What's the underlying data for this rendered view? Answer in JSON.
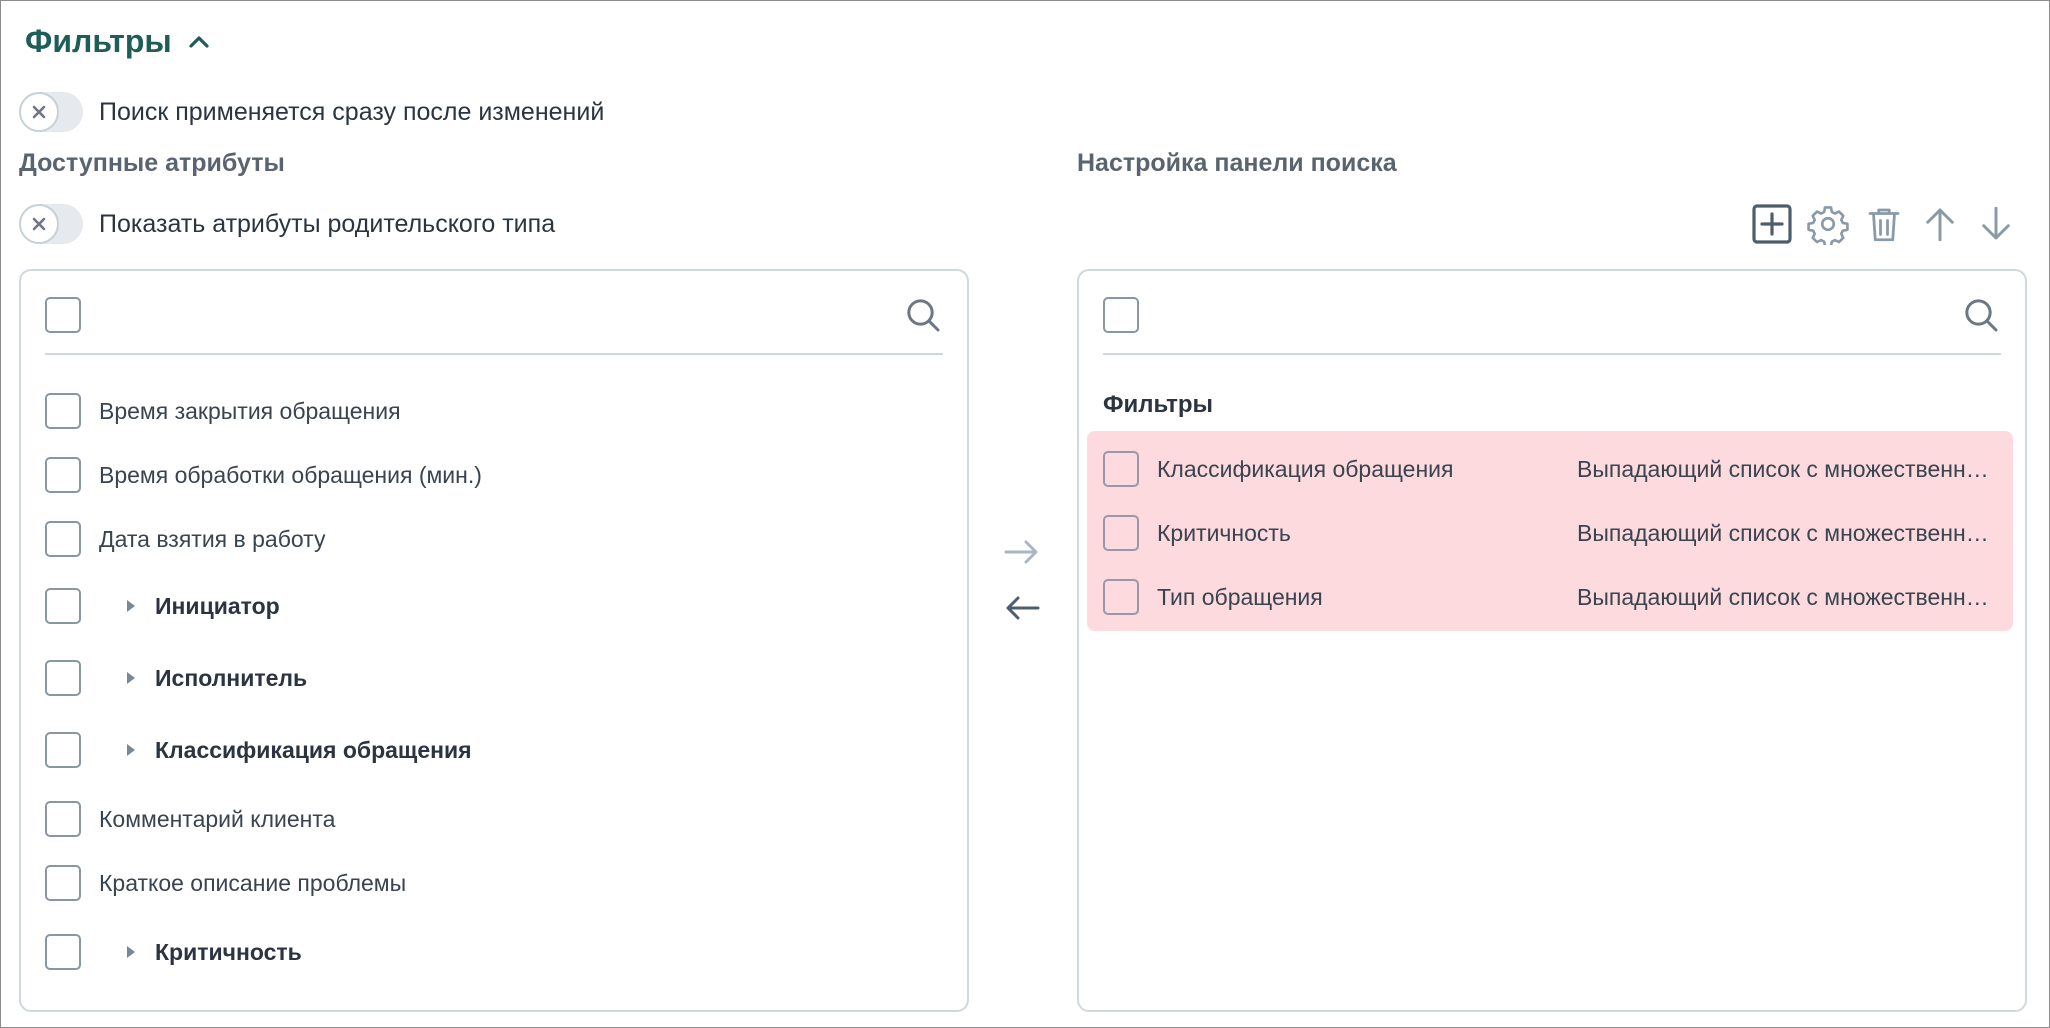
{
  "header": {
    "title": "Фильтры"
  },
  "toggles": {
    "instant_search": {
      "label": "Поиск применяется сразу после изменений",
      "on": false
    },
    "parent_attrs": {
      "label": "Показать атрибуты родительского типа",
      "on": false
    }
  },
  "left_panel": {
    "title": "Доступные атрибуты",
    "search_placeholder": "",
    "items": [
      {
        "label": "Время закрытия обращения",
        "expandable": false
      },
      {
        "label": "Время обработки обращения (мин.)",
        "expandable": false
      },
      {
        "label": "Дата взятия в работу",
        "expandable": false
      },
      {
        "label": "Инициатор",
        "expandable": true
      },
      {
        "label": "Исполнитель",
        "expandable": true
      },
      {
        "label": "Классификация обращения",
        "expandable": true
      },
      {
        "label": "Комментарий клиента",
        "expandable": false
      },
      {
        "label": "Краткое описание проблемы",
        "expandable": false
      },
      {
        "label": "Критичность",
        "expandable": true
      }
    ]
  },
  "right_panel": {
    "title": "Настройка панели поиска",
    "search_placeholder": "",
    "group_title": "Фильтры",
    "items": [
      {
        "name": "Классификация обращения",
        "type": "Выпадающий список с множественн…"
      },
      {
        "name": "Критичность",
        "type": "Выпадающий список с множественн…"
      },
      {
        "name": "Тип обращения",
        "type": "Выпадающий список с множественн…"
      }
    ]
  },
  "toolbar": {
    "icons": [
      "add-box-icon",
      "gear-icon",
      "trash-icon",
      "arrow-up-icon",
      "arrow-down-icon"
    ]
  },
  "colors": {
    "accent": "#1e5e57",
    "highlight": "#fcdadd",
    "border": "#cfd8e0",
    "icon": "#8a9aa9"
  }
}
